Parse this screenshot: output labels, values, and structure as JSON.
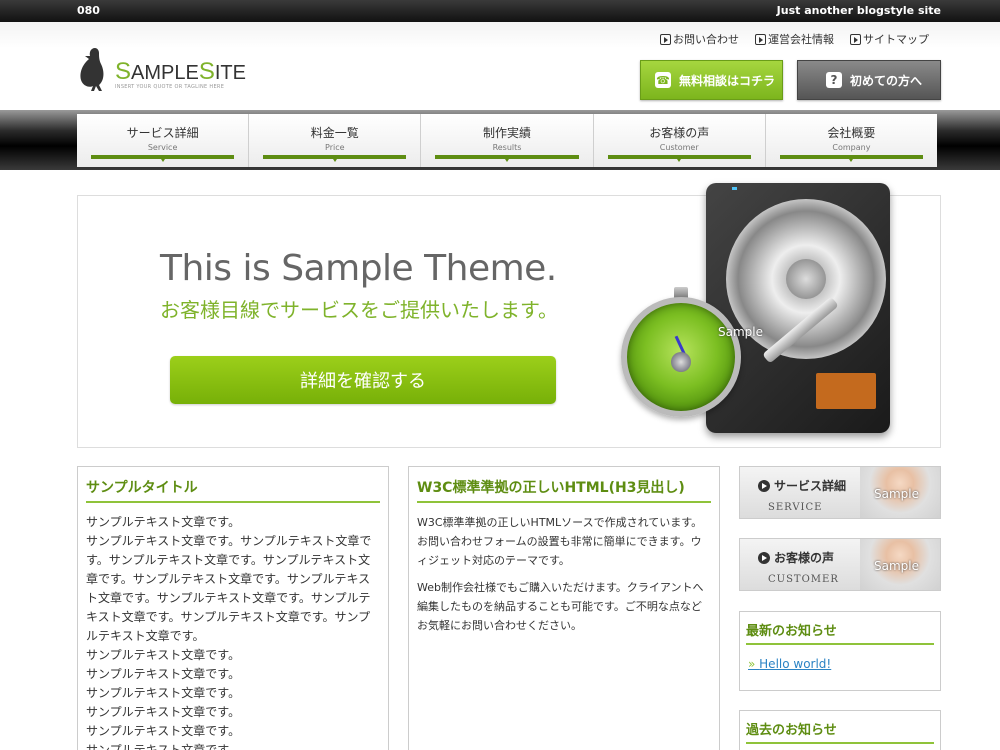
{
  "topbar": {
    "left_text": "080",
    "right_text": "Just another blogstyle site"
  },
  "logo": {
    "prefix1": "S",
    "word1": "AMPLE",
    "prefix2": "S",
    "word2": "ITE",
    "tagline": "INSERT YOUR QUOTE OR TAGLINE HERE"
  },
  "toplinks": [
    {
      "label": "お問い合わせ"
    },
    {
      "label": "運営会社情報"
    },
    {
      "label": "サイトマップ"
    }
  ],
  "buttons": {
    "free_consult": "無料相談はコチラ",
    "first_time": "初めての方へ"
  },
  "nav": [
    {
      "jp": "サービス詳細",
      "en": "Service"
    },
    {
      "jp": "料金一覧",
      "en": "Price"
    },
    {
      "jp": "制作実績",
      "en": "Results"
    },
    {
      "jp": "お客様の声",
      "en": "Customer"
    },
    {
      "jp": "会社概要",
      "en": "Company"
    }
  ],
  "hero": {
    "title": "This is Sample Theme.",
    "subtitle": "お客様目線でサービスをご提供いたします。",
    "cta": "詳細を確認する",
    "image_label": "Sample"
  },
  "col1": {
    "title": "サンプルタイトル",
    "text": "サンプルテキスト文章です。\nサンプルテキスト文章です。サンプルテキスト文章です。サンプルテキスト文章です。サンプルテキスト文章です。サンプルテキスト文章です。サンプルテキスト文章です。サンプルテキスト文章です。サンプルテキスト文章です。サンプルテキスト文章です。サンプルテキスト文章です。\nサンプルテキスト文章です。\nサンプルテキスト文章です。\nサンプルテキスト文章です。\nサンプルテキスト文章です。\nサンプルテキスト文章です。\nサンプルテキスト文章です。"
  },
  "col2": {
    "title": "W3C標準準拠の正しいHTML(H3見出し)",
    "p1": "W3C標準準拠の正しいHTMLソースで作成されています。お問い合わせフォームの設置も非常に簡単にできます。ウィジェット対応のテーマです。",
    "p2": "Web制作会社様でもご購入いただけます。クライアントへ編集したものを納品することも可能です。ご不明な点などお気軽にお問い合わせください。"
  },
  "sidebar": {
    "banner1": {
      "jp": "サービス詳細",
      "en": "SERVICE",
      "photo_label": "Sample"
    },
    "banner2": {
      "jp": "お客様の声",
      "en": "CUSTOMER",
      "photo_label": "Sample"
    },
    "news_title": "最新のお知らせ",
    "news_item": "Hello world!",
    "past_title": "過去のお知らせ"
  },
  "colors": {
    "accent_green": "#7fb32b",
    "dark_green": "#5e8d12",
    "link_blue": "#2b83c4"
  }
}
